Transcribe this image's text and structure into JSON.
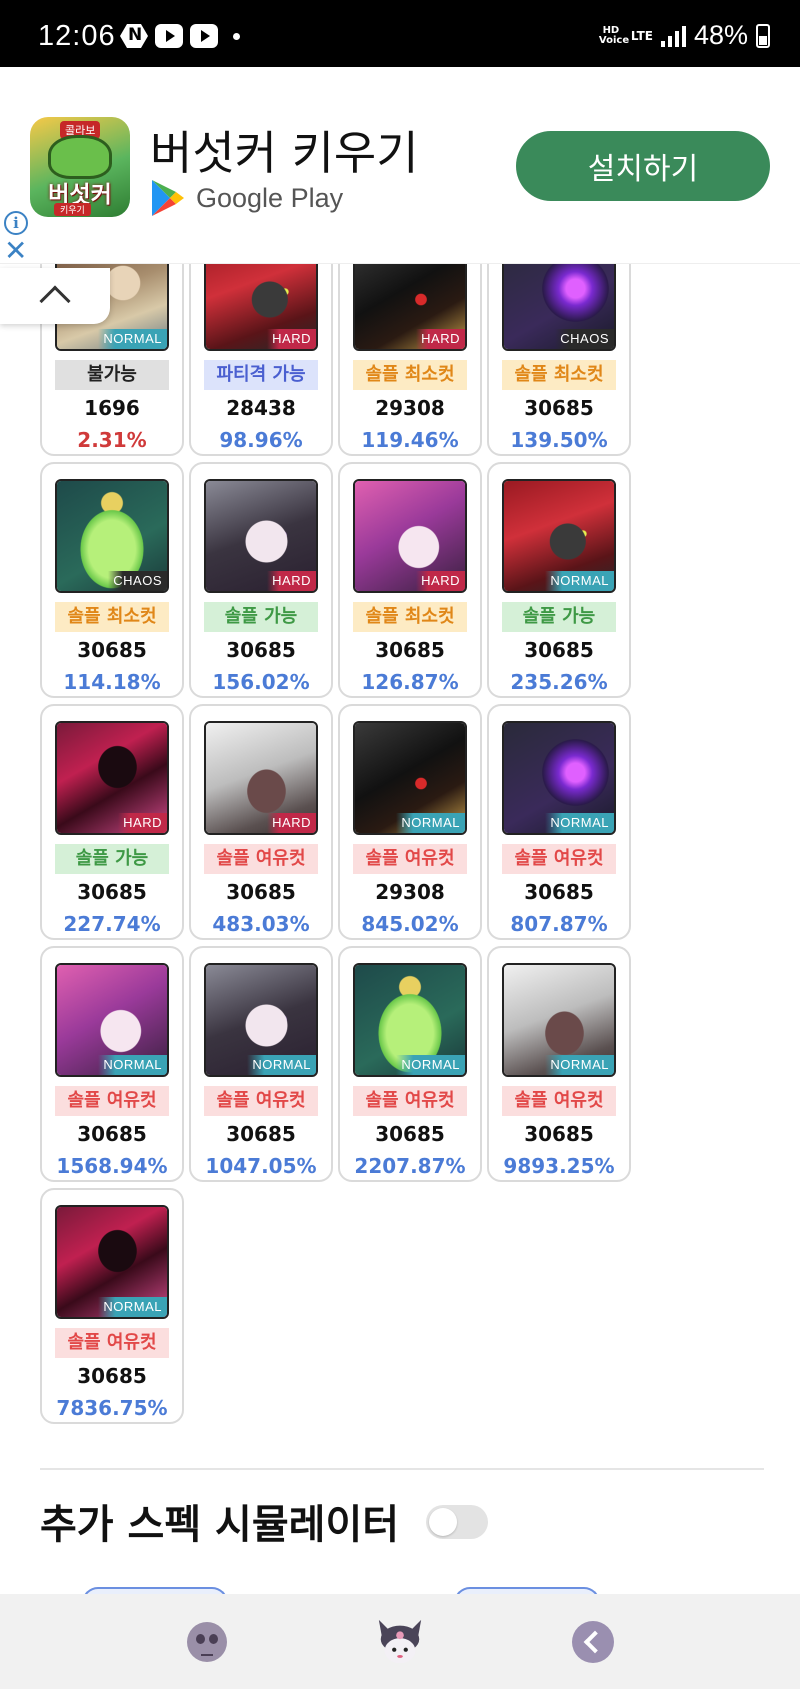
{
  "status_bar": {
    "time": "12:06",
    "battery_percent": "48%",
    "network": "LTE",
    "hd_voice": "HD Voice"
  },
  "ad": {
    "app_icon_tag": "콜라보",
    "app_icon_logo": "버섯커",
    "app_icon_sub": "키우기",
    "title": "버섯커 키우기",
    "store": "Google Play",
    "install_label": "설치하기"
  },
  "bosses": [
    {
      "art": "boss-brown-hair",
      "difficulty": "NORMAL",
      "status": "불가능",
      "status_type": "none",
      "power": "1696",
      "percent": "2.31%",
      "low": true
    },
    {
      "art": "boss-red-hair",
      "difficulty": "HARD",
      "status": "파티격 가능",
      "status_type": "party",
      "power": "28438",
      "percent": "98.96%",
      "low": false
    },
    {
      "art": "boss-black-armor",
      "difficulty": "HARD",
      "status": "솔플 최소컷",
      "status_type": "min",
      "power": "29308",
      "percent": "119.46%",
      "low": false
    },
    {
      "art": "boss-purple-orb",
      "difficulty": "CHAOS",
      "status": "솔플 최소컷",
      "status_type": "min",
      "power": "30685",
      "percent": "139.50%",
      "low": false
    },
    {
      "art": "boss-green-slime",
      "difficulty": "CHAOS",
      "status": "솔플 최소컷",
      "status_type": "min",
      "power": "30685",
      "percent": "114.18%",
      "low": false
    },
    {
      "art": "boss-glasses",
      "difficulty": "HARD",
      "status": "솔플 가능",
      "status_type": "ok",
      "power": "30685",
      "percent": "156.02%",
      "low": false
    },
    {
      "art": "boss-pink-hair",
      "difficulty": "HARD",
      "status": "솔플 최소컷",
      "status_type": "min",
      "power": "30685",
      "percent": "126.87%",
      "low": false
    },
    {
      "art": "boss-red-hair",
      "difficulty": "NORMAL",
      "status": "솔플 가능",
      "status_type": "ok",
      "power": "30685",
      "percent": "235.26%",
      "low": false
    },
    {
      "art": "boss-dark-red",
      "difficulty": "HARD",
      "status": "솔플 가능",
      "status_type": "ok",
      "power": "30685",
      "percent": "227.74%",
      "low": false
    },
    {
      "art": "boss-white-hair",
      "difficulty": "HARD",
      "status": "솔플 여유컷",
      "status_type": "easy",
      "power": "30685",
      "percent": "483.03%",
      "low": false
    },
    {
      "art": "boss-black-armor",
      "difficulty": "NORMAL",
      "status": "솔플 여유컷",
      "status_type": "easy",
      "power": "29308",
      "percent": "845.02%",
      "low": false
    },
    {
      "art": "boss-purple-orb",
      "difficulty": "NORMAL",
      "status": "솔플 여유컷",
      "status_type": "easy",
      "power": "30685",
      "percent": "807.87%",
      "low": false
    },
    {
      "art": "boss-pink-hair",
      "difficulty": "NORMAL",
      "status": "솔플 여유컷",
      "status_type": "easy",
      "power": "30685",
      "percent": "1568.94%",
      "low": false
    },
    {
      "art": "boss-glasses",
      "difficulty": "NORMAL",
      "status": "솔플 여유컷",
      "status_type": "easy",
      "power": "30685",
      "percent": "1047.05%",
      "low": false
    },
    {
      "art": "boss-green-slime",
      "difficulty": "NORMAL",
      "status": "솔플 여유컷",
      "status_type": "easy",
      "power": "30685",
      "percent": "2207.87%",
      "low": false
    },
    {
      "art": "boss-white-hair",
      "difficulty": "NORMAL",
      "status": "솔플 여유컷",
      "status_type": "easy",
      "power": "30685",
      "percent": "9893.25%",
      "low": false
    },
    {
      "art": "boss-dark-red",
      "difficulty": "NORMAL",
      "status": "솔플 여유컷",
      "status_type": "easy",
      "power": "30685",
      "percent": "7836.75%",
      "low": false
    }
  ],
  "simulator": {
    "title": "추가 스펙 시뮬레이터",
    "toggle_on": false
  },
  "bottom_nav": {
    "items": [
      "skull-icon",
      "kuromi-icon",
      "back-icon"
    ]
  },
  "colors": {
    "install_button": "#3a8a5a",
    "percent_blue": "#4b7bd6",
    "percent_red": "#d03a3a",
    "status_min_text": "#e08718",
    "status_ok_text": "#3e9945",
    "status_easy_text": "#e24848",
    "status_party_text": "#4a5fd0"
  }
}
